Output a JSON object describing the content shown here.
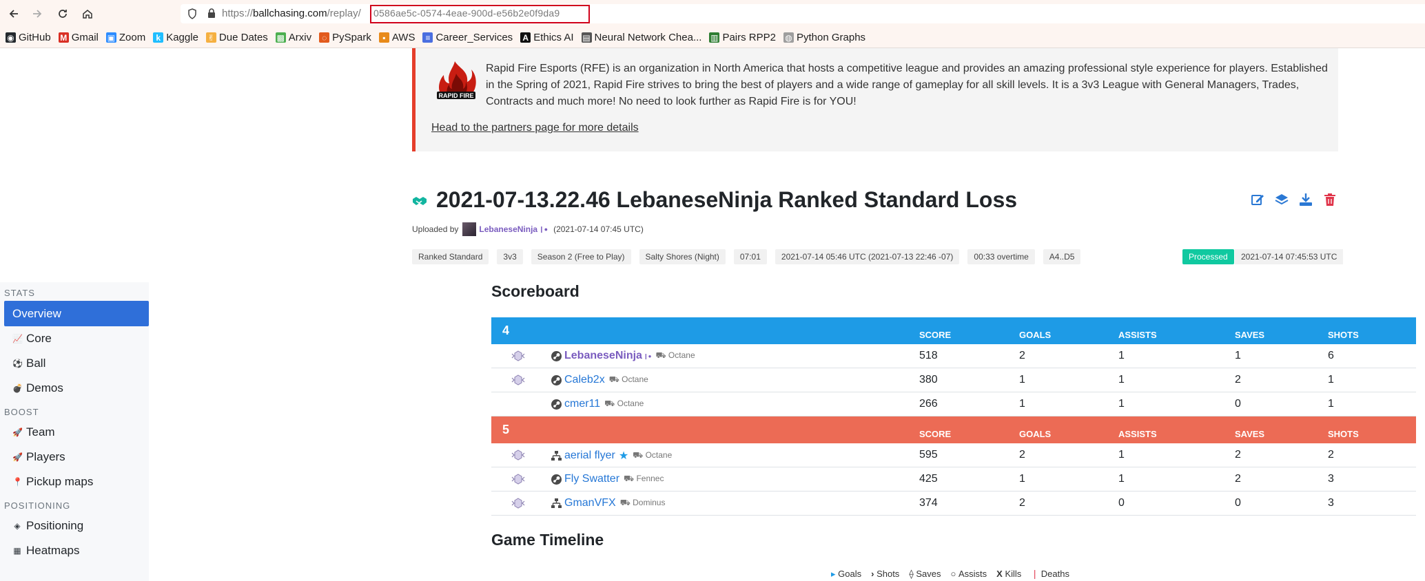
{
  "browser": {
    "url_prefix": "https://",
    "url_domain": "ballchasing.com",
    "url_path": "/replay/",
    "url_id": "0586ae5c-0574-4eae-900d-e56b2e0f9da9",
    "bookmarks": [
      {
        "label": "GitHub",
        "icon": "github-icon",
        "color": "#24292e"
      },
      {
        "label": "Gmail",
        "icon": "gmail-icon",
        "color": "#d93025"
      },
      {
        "label": "Zoom",
        "icon": "zoom-icon",
        "color": "#2d8cff"
      },
      {
        "label": "Kaggle",
        "icon": "kaggle-icon",
        "color": "#20beff"
      },
      {
        "label": "Due Dates",
        "icon": "hand-icon",
        "color": "#f5b041"
      },
      {
        "label": "Arxiv",
        "icon": "arxiv-icon",
        "color": "#4caf50"
      },
      {
        "label": "PySpark",
        "icon": "pyspark-icon",
        "color": "#e25a1c"
      },
      {
        "label": "AWS",
        "icon": "aws-icon",
        "color": "#e88a1a"
      },
      {
        "label": "Career_Services",
        "icon": "doc-icon",
        "color": "#4a6ee0"
      },
      {
        "label": "Ethics AI",
        "icon": "ethics-icon",
        "color": "#111111"
      },
      {
        "label": "Neural Network Chea...",
        "icon": "nn-icon",
        "color": "#555555"
      },
      {
        "label": "Pairs RPP2",
        "icon": "pairs-icon",
        "color": "#2e7d32"
      },
      {
        "label": "Python Graphs",
        "icon": "python-graphs-icon",
        "color": "#9e9e9e"
      }
    ]
  },
  "sidebar": {
    "sections": [
      {
        "heading": "STATS",
        "items": [
          {
            "label": "Overview",
            "icon": "home-icon",
            "active": true
          },
          {
            "label": "Core",
            "icon": "line-chart-icon"
          },
          {
            "label": "Ball",
            "icon": "ball-icon"
          },
          {
            "label": "Demos",
            "icon": "bomb-icon"
          }
        ]
      },
      {
        "heading": "BOOST",
        "items": [
          {
            "label": "Team",
            "icon": "rocket-icon"
          },
          {
            "label": "Players",
            "icon": "rocket-icon"
          },
          {
            "label": "Pickup maps",
            "icon": "map-marker-icon"
          }
        ]
      },
      {
        "heading": "POSITIONING",
        "items": [
          {
            "label": "Positioning",
            "icon": "crosshair-icon"
          },
          {
            "label": "Heatmaps",
            "icon": "heatmap-icon"
          }
        ]
      }
    ]
  },
  "partner": {
    "logo_text": "RAPID FIRE",
    "description": "Rapid Fire Esports (RFE) is an organization in North America that hosts a competitive league and provides an amazing professional style experience for players. Established in the Spring of 2021, Rapid Fire strives to bring the best of players and a wide range of gameplay for all skill levels. It is a 3v3 League with General Managers, Trades, Contracts and much more! No need to look further as Rapid Fire is for YOU!",
    "link": "Head to the partners page for more details",
    "accent": "#e53e2b"
  },
  "replay": {
    "title": "2021-07-13.22.46 LebaneseNinja Ranked Standard Loss",
    "uploaded_by_label": "Uploaded by",
    "uploader": "LebaneseNinja",
    "uploaded_at": "(2021-07-14 07:45 UTC)",
    "tags": [
      "Ranked Standard",
      "3v3",
      "Season 2 (Free to Play)",
      "Salty Shores (Night)",
      "07:01",
      "2021-07-14 05:46 UTC (2021-07-13 22:46 -07)",
      "00:33 overtime",
      "A4..D5"
    ],
    "status": "Processed",
    "status_time": "2021-07-14 07:45:53 UTC",
    "status_color": "#10c9a0"
  },
  "scoreboard": {
    "title": "Scoreboard",
    "columns": [
      "SCORE",
      "GOALS",
      "ASSISTS",
      "SAVES",
      "SHOTS"
    ],
    "teams": [
      {
        "score": "4",
        "color": "#1e9be6",
        "players": [
          {
            "name": "LebaneseNinja",
            "car": "Octane",
            "platform": "steam-icon",
            "score": "518",
            "goals": "2",
            "assists": "1",
            "saves": "1",
            "shots": "6",
            "rank": true
          },
          {
            "name": "Caleb2x",
            "car": "Octane",
            "platform": "steam-icon",
            "score": "380",
            "goals": "1",
            "assists": "1",
            "saves": "2",
            "shots": "1",
            "rank": true
          },
          {
            "name": "cmer11",
            "car": "Octane",
            "platform": "steam-icon",
            "score": "266",
            "goals": "1",
            "assists": "1",
            "saves": "0",
            "shots": "1",
            "rank": false
          }
        ]
      },
      {
        "score": "5",
        "color": "#ec6b55",
        "players": [
          {
            "name": "aerial flyer",
            "car": "Octane",
            "platform": "epic-icon",
            "score": "595",
            "goals": "2",
            "assists": "1",
            "saves": "2",
            "shots": "2",
            "rank": true
          },
          {
            "name": "Fly Swatter",
            "car": "Fennec",
            "platform": "steam-icon",
            "score": "425",
            "goals": "1",
            "assists": "1",
            "saves": "2",
            "shots": "3",
            "rank": true
          },
          {
            "name": "GmanVFX",
            "car": "Dominus",
            "platform": "epic-icon",
            "score": "374",
            "goals": "2",
            "assists": "0",
            "saves": "0",
            "shots": "3",
            "rank": true
          }
        ]
      }
    ]
  },
  "timeline": {
    "title": "Game Timeline",
    "legend": [
      "Goals",
      "Shots",
      "Saves",
      "Assists",
      "Kills",
      "Deaths"
    ]
  }
}
